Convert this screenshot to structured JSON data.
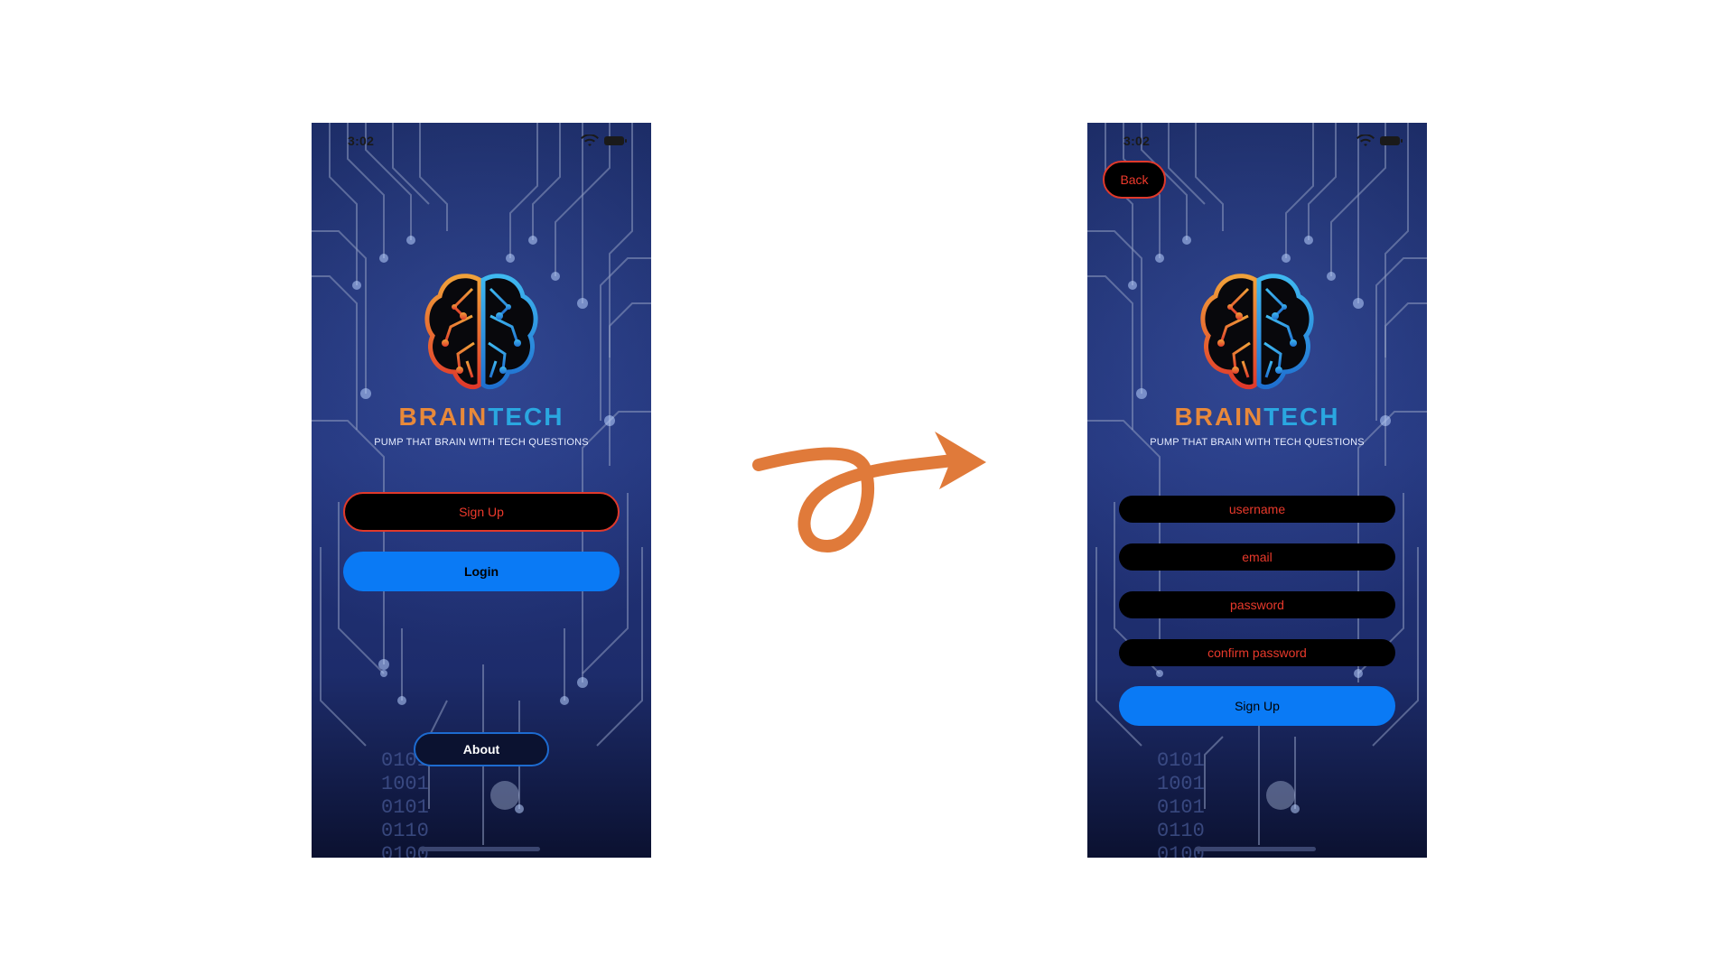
{
  "left_screen": {
    "status": {
      "time": "3:02"
    },
    "brand": {
      "name_part1": "BRAIN",
      "name_part2": "TECH",
      "tagline": "PUMP THAT BRAIN WITH TECH QUESTIONS"
    },
    "buttons": {
      "signup": "Sign Up",
      "login": "Login",
      "about": "About"
    }
  },
  "right_screen": {
    "status": {
      "time": "3:02"
    },
    "back_label": "Back",
    "brand": {
      "name_part1": "BRAIN",
      "name_part2": "TECH",
      "tagline": "PUMP THAT BRAIN WITH TECH QUESTIONS"
    },
    "fields": {
      "username_placeholder": "username",
      "email_placeholder": "email",
      "password_placeholder": "password",
      "confirm_password_placeholder": "confirm password"
    },
    "signup_label": "Sign Up"
  },
  "background_binary_lines": [
    "0101",
    "1001",
    "0101",
    "0110",
    "0100"
  ],
  "colors": {
    "accent_red": "#e0392b",
    "accent_blue": "#0a7af5",
    "brand_orange": "#e8893a",
    "brand_cyan": "#2aa7e0",
    "transition_arrow": "#e07a3a"
  },
  "icons": [
    "wifi-icon",
    "battery-icon",
    "brain-logo-icon",
    "transition-arrow-icon"
  ]
}
